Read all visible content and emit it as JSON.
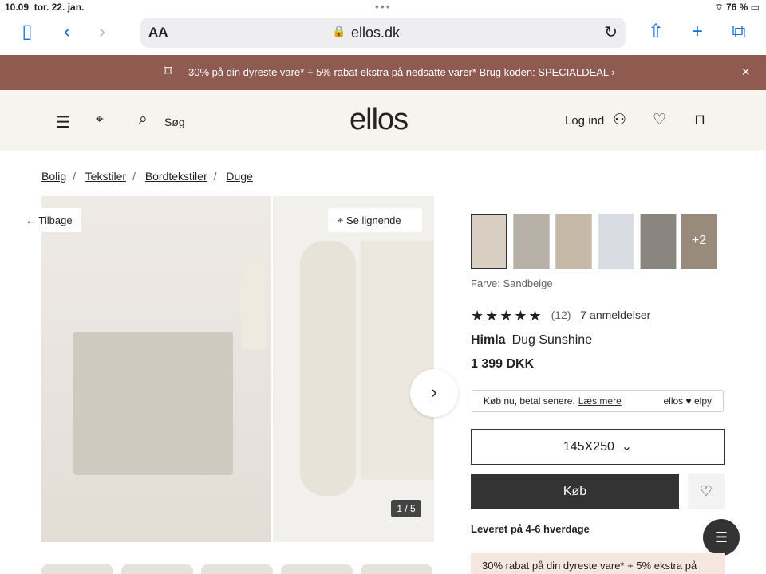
{
  "status": {
    "time": "10.09",
    "date": "tor. 22. jan.",
    "battery": "76 %"
  },
  "browser": {
    "aa": "AA",
    "url": "ellos.dk"
  },
  "promo": {
    "text": "30% på din dyreste vare* + 5% rabat ekstra på nedsatte varer* Brug koden: SPECIALDEAL ›"
  },
  "header": {
    "search": "Søg",
    "logo": "ellos",
    "login": "Log ind"
  },
  "breadcrumb": [
    "Bolig",
    "Tekstiler",
    "Bordtekstiler",
    "Duge"
  ],
  "gallery": {
    "back": "Tilbage",
    "similar": "Se lignende",
    "counter": "1 / 5"
  },
  "product": {
    "color_label": "Farve: Sandbeige",
    "swatch_more": "+2",
    "stars": "★★★★★",
    "rating_count": "(12)",
    "reviews_link": "7 anmeldelser",
    "brand": "Himla",
    "name": "Dug Sunshine",
    "price": "1 399 DKK",
    "klarna_text": "Køb nu, betal senere.",
    "klarna_link": "Læs mere",
    "klarna_logo": "ellos ♥ elpy",
    "size": "145X250",
    "buy": "Køb",
    "delivery": "Leveret på 4-6 hverdage",
    "bottom_promo": "30% rabat på din dyreste vare* + 5% ekstra på"
  }
}
